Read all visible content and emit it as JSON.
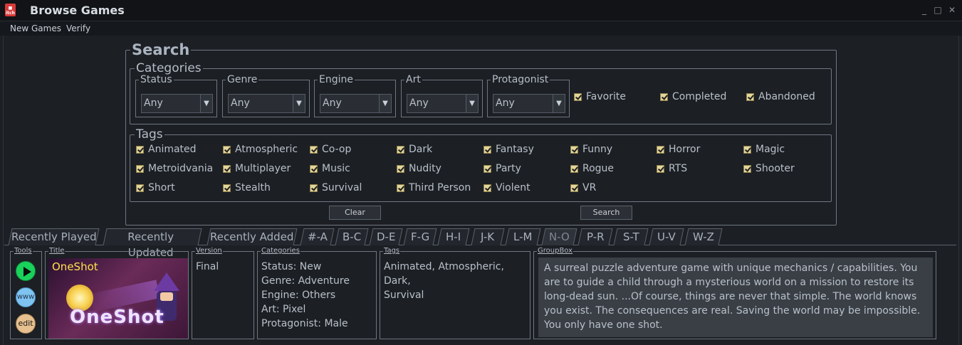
{
  "window": {
    "title": "Browse Games",
    "icon": "itch-io-icon",
    "minimize": "_",
    "maximize": "□",
    "close": "✕"
  },
  "menu": [
    "New Games",
    "Verify"
  ],
  "search": {
    "title": "Search",
    "categories": {
      "title": "Categories",
      "combos": [
        {
          "label": "Status",
          "value": "Any"
        },
        {
          "label": "Genre",
          "value": "Any"
        },
        {
          "label": "Engine",
          "value": "Any"
        },
        {
          "label": "Art",
          "value": "Any"
        },
        {
          "label": "Protagonist",
          "value": "Any"
        }
      ],
      "checks": [
        {
          "label": "Favorite",
          "checked": true
        },
        {
          "label": "Completed",
          "checked": true
        },
        {
          "label": "Abandoned",
          "checked": true
        }
      ]
    },
    "tags": {
      "title": "Tags",
      "items": [
        "Animated",
        "Atmospheric",
        "Co-op",
        "Dark",
        "Fantasy",
        "Funny",
        "Horror",
        "Magic",
        "Metroidvania",
        "Multiplayer",
        "Music",
        "Nudity",
        "Party",
        "Rogue",
        "RTS",
        "Shooter",
        "Short",
        "Stealth",
        "Survival",
        "Third Person",
        "Violent",
        "VR"
      ]
    },
    "clear_label": "Clear",
    "search_label": "Search"
  },
  "tabs": [
    "Recently Played",
    "Recently Updated",
    "Recently Added",
    "#-A",
    "B-C",
    "D-E",
    "F-G",
    "H-I",
    "J-K",
    "L-M",
    "N-O",
    "P-R",
    "S-T",
    "U-V",
    "W-Z"
  ],
  "active_tab": "N-O",
  "details": {
    "tools_label": "Tools",
    "play_icon": "play-icon",
    "www_label": "www",
    "edit_label": "edit",
    "title_label": "Title",
    "game_title": "OneShot",
    "cover_logo": "OneShot",
    "version_label": "Version",
    "version": "Final",
    "categories_label": "Categories",
    "categories": "Status: New\nGenre: Adventure\nEngine: Others\nArt: Pixel\nProtagonist: Male",
    "tags_label": "Tags",
    "tags": "Animated, Atmospheric, Dark,\nSurvival",
    "group_label": "GroupBox",
    "description": "A surreal puzzle adventure game with unique mechanics / capabilities. You are to guide a child through a mysterious world on a mission to restore its long-dead sun. ...Of course, things are never that simple. The world knows you exist. The consequences are real. Saving the world may be impossible. You only have one shot."
  },
  "colors": {
    "accent_check": "#e3d59a",
    "play_green": "#19d15b",
    "www_blue": "#7fc3f0",
    "edit_tan": "#e7c08f"
  }
}
